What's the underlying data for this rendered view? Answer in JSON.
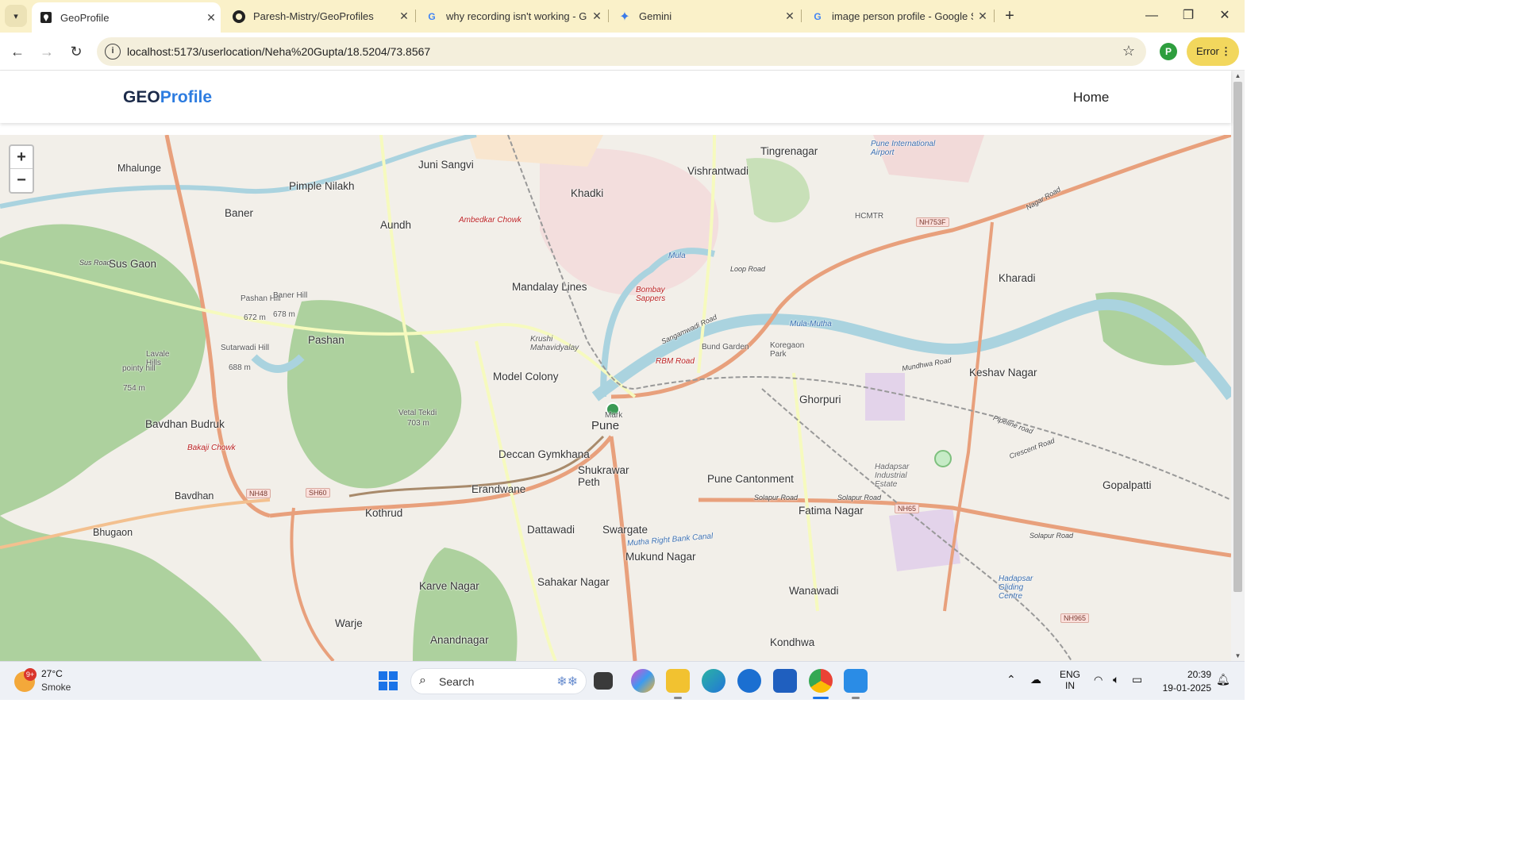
{
  "browser": {
    "tabs": [
      {
        "title": "GeoProfile",
        "icon": "map-pin-icon",
        "active": true
      },
      {
        "title": "Paresh-Mistry/GeoProfiles",
        "icon": "github-icon",
        "active": false
      },
      {
        "title": "why recording isn't working - G",
        "icon": "google-icon",
        "active": false
      },
      {
        "title": "Gemini",
        "icon": "gemini-icon",
        "active": false
      },
      {
        "title": "image person profile - Google S",
        "icon": "google-icon",
        "active": false
      }
    ],
    "url": "localhost:5173/userlocation/Neha%20Gupta/18.5204/73.8567",
    "profile_initial": "P",
    "error_label": "Error",
    "accent": "#faf1c9"
  },
  "app": {
    "brand_part1": "GEO",
    "brand_part2": "Profile",
    "nav_home": "Home",
    "brand_color": "#2d7ce0"
  },
  "map": {
    "zoom_in": "+",
    "zoom_out": "−",
    "marker_label": "Mark",
    "places": {
      "mhalunge": "Mhalunge",
      "juni_sangvi": "Juni Sangvi",
      "vishrantwadi": "Vishrantwadi",
      "tingrenagar": "Tingrenagar",
      "pune_airport": "Pune International Airport",
      "pimple_nilakh": "Pimple Nilakh",
      "khadki": "Khadki",
      "baner": "Baner",
      "aundh": "Aundh",
      "ambedkar_chowk": "Ambedkar Chowk",
      "hcmtr": "HCMTR",
      "sus_gaon": "Sus Gaon",
      "sus_road": "Sus Road",
      "mandalay_lines": "Mandalay Lines",
      "bombay_sappers": "Bombay Sappers",
      "kharadi": "Kharadi",
      "pashan_hill": "Pashan Hill",
      "pashan_hill_elev": "672 m",
      "baner_hill": "Baner Hill",
      "baner_hill_elev": "678 m",
      "pashan": "Pashan",
      "krushi": "Krushi Mahavidyalay",
      "koregaon_park": "Koregaon Park",
      "bund_garden": "Bund Garden",
      "sutarwadi": "Sutarwadi Hill",
      "sutarwadi_elev": "688 m",
      "lavale_hills": "Lavale Hills",
      "pointy_hill": "pointy hill",
      "pointy_hill_elev": "754 m",
      "rbm_road": "RBM Road",
      "model_colony": "Model Colony",
      "keshav_nagar": "Keshav Nagar",
      "ghorpuri": "Ghorpuri",
      "vetal_tekdi": "Vetal Tekdi",
      "vetal_tekdi_elev": "703 m",
      "pune": "Pune",
      "bavdhan_budruk": "Bavdhan Budruk",
      "bakaji_chowk": "Bakaji Chowk",
      "deccan_gymkhana": "Deccan Gymkhana",
      "hadapsar_estate": "Hadapsar Industrial Estate",
      "shukrawar_peth": "Shukrawar Peth",
      "pune_cantonment": "Pune Cantonment",
      "gopalpatti": "Gopalpatti",
      "bavdhan": "Bavdhan",
      "erandwane": "Erandwane",
      "kothrud": "Kothrud",
      "fatima_nagar": "Fatima Nagar",
      "dattawadi": "Dattawadi",
      "swargate": "Swargate",
      "bhugaon": "Bhugaon",
      "mukund_nagar": "Mukund Nagar",
      "hadapsar_gliding": "Hadapsar Gliding Centre",
      "karve_nagar": "Karve Nagar",
      "sahakar_nagar": "Sahakar Nagar",
      "wanawadi": "Wanawadi",
      "warje": "Warje",
      "anandnagar": "Anandnagar",
      "kondhwa": "Kondhwa",
      "mula": "Mula",
      "mula_mutha": "Mula-Mutha",
      "loop_road": "Loop Road",
      "sangamwadi_road": "Sangamwadi Road",
      "mundhwa_road": "Mundhwa Road",
      "solapur_road": "Solapur Road",
      "nagar_road": "Nagar Road",
      "pipeline_road": "Pipeline road",
      "crescent_road": "Crescent Road",
      "mutha_right_bank": "Mutha Right Bank Canal"
    },
    "shields": {
      "nh753f": "NH753F",
      "nh48": "NH48",
      "sh60": "SH60",
      "nh65": "NH65",
      "nh965": "NH965"
    },
    "colors": {
      "land": "#f2efe9",
      "forest": "#add19e",
      "water": "#aad3df",
      "major_road": "#e8a07c",
      "minor_road": "#f6fabe"
    }
  },
  "taskbar": {
    "weather_temp": "27°C",
    "weather_cond": "Smoke",
    "weather_badge": "9+",
    "search_label": "Search",
    "lang1": "ENG",
    "lang2": "IN",
    "time": "20:39",
    "date": "19-01-2025"
  }
}
